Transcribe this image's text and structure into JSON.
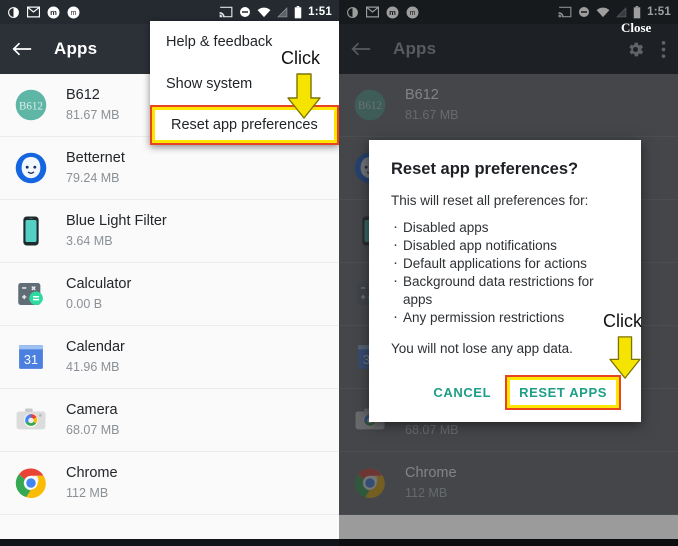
{
  "status_bar": {
    "icons": [
      "brightness-icon",
      "gmail-icon",
      "app-m-icon",
      "app-m2-icon"
    ],
    "right_icons": [
      "cast-icon",
      "do-not-disturb-icon",
      "wifi-icon",
      "signal-icon",
      "battery-icon"
    ],
    "time": "1:51"
  },
  "toolbar": {
    "back_icon": "back-arrow-icon",
    "title": "Apps",
    "settings_icon": "gear-icon",
    "overflow_icon": "overflow-menu-icon"
  },
  "overflow_menu": {
    "items": [
      {
        "label": "Help & feedback",
        "highlighted": false
      },
      {
        "label": "Show system",
        "highlighted": false
      },
      {
        "label": "Reset app preferences",
        "highlighted": true
      }
    ]
  },
  "callouts": {
    "click_left": "Click",
    "click_right": "Click",
    "close": "Close",
    "arrow_icon": "down-arrow-icon"
  },
  "apps": [
    {
      "name": "B612",
      "size": "81.67 MB",
      "icon": "b612-icon"
    },
    {
      "name": "Betternet",
      "size": "79.24 MB",
      "icon": "betternet-icon"
    },
    {
      "name": "Blue Light Filter",
      "size": "3.64 MB",
      "icon": "blue-light-filter-icon"
    },
    {
      "name": "Calculator",
      "size": "0.00 B",
      "icon": "calculator-icon"
    },
    {
      "name": "Calendar",
      "size": "41.96 MB",
      "icon": "calendar-icon"
    },
    {
      "name": "Camera",
      "size": "68.07 MB",
      "icon": "camera-icon"
    },
    {
      "name": "Chrome",
      "size": "112 MB",
      "icon": "chrome-icon"
    }
  ],
  "dialog": {
    "title": "Reset app preferences?",
    "lead": "This will reset all preferences for:",
    "bullets": [
      "Disabled apps",
      "Disabled app notifications",
      "Default applications for actions",
      "Background data restrictions for",
      "apps",
      "Any permission restrictions"
    ],
    "note": "You will not lose any app data.",
    "cancel_label": "CANCEL",
    "confirm_label": "RESET APPS"
  },
  "colors": {
    "toolbar": "#2b3137",
    "status_bar": "#242a30",
    "accent_teal": "#1e9e87",
    "highlight_yellow": "#ffe600",
    "highlight_red": "#e8441f",
    "arrow_yellow": "#f5e400"
  }
}
